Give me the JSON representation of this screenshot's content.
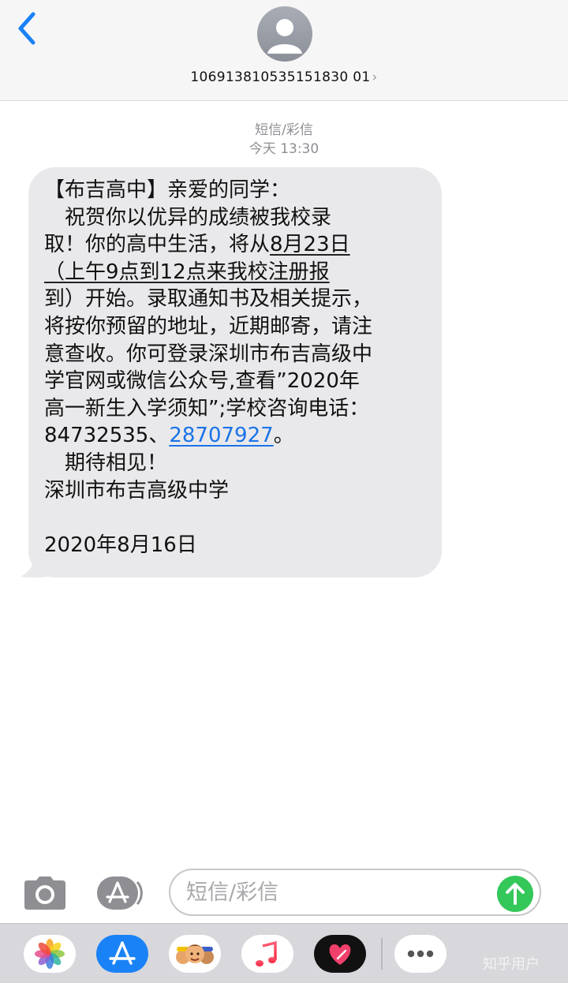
{
  "header": {
    "contact_number": "106913810535151830 01",
    "contact_chevron": "›"
  },
  "meta": {
    "message_type": "短信/彩信",
    "timestamp": "今天 13:30"
  },
  "message": {
    "lines": [
      "【布吉高中】亲爱的同学：",
      "　祝贺你以优异的成绩被我校录",
      "取！你的高中生活，将从",
      "8月23日",
      "（上午9点到12点来我校注册报",
      "到）开始。录取通知书及相关提示，",
      "将按你预留的地址，近期邮寄，请注",
      "意查收。你可登录深圳市布吉高级中",
      "学官网或微信公众号,查看”2020年",
      "高一新生入学须知”;学校咨询电话：",
      "84732535、",
      "28707927",
      "。",
      "　期待相见！",
      "深圳市布吉高级中学",
      "2020年8月16日"
    ]
  },
  "input": {
    "placeholder": "短信/彩信"
  },
  "drawer": {
    "apps": [
      "photos-icon",
      "app-store-icon",
      "memoji-icon",
      "music-icon",
      "digital-touch-icon",
      "more-icon"
    ]
  },
  "watermark": "知乎用户",
  "colors": {
    "accent": "#1a82f7",
    "bubble": "#e9e9eb",
    "send": "#34c759",
    "link": "#1a73e8"
  }
}
